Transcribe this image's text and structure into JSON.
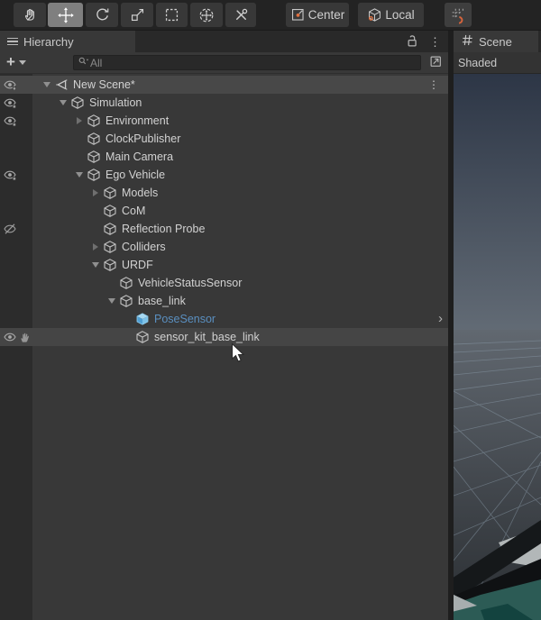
{
  "toolbar": {
    "tools": [
      {
        "id": "hand",
        "name": "hand-tool",
        "selected": false
      },
      {
        "id": "move",
        "name": "move-tool",
        "selected": true
      },
      {
        "id": "rotate",
        "name": "rotate-tool",
        "selected": false
      },
      {
        "id": "scale",
        "name": "scale-tool",
        "selected": false
      },
      {
        "id": "rect",
        "name": "rect-tool",
        "selected": false
      },
      {
        "id": "transform",
        "name": "transform-tool",
        "selected": false
      },
      {
        "id": "custom",
        "name": "custom-editor-tools",
        "selected": false
      }
    ],
    "pivot_label": "Center",
    "orientation_label": "Local",
    "grid_snap_icon": "grid-snap-icon"
  },
  "hierarchy": {
    "tab_label": "Hierarchy",
    "tab_icons": [
      "hamburger-menu-icon",
      "unlock-icon",
      "kebab-menu-icon"
    ],
    "add_button": "+",
    "search_placeholder": "All",
    "search_icons": [
      "search-filter-icon",
      "open-search-window-icon"
    ],
    "rows": [
      {
        "label": "New Scene*",
        "level": 0,
        "expand": "open",
        "icon": "unity",
        "eye": "dot",
        "header": true,
        "menu": true
      },
      {
        "label": "Simulation",
        "level": 1,
        "expand": "open",
        "icon": "cube",
        "eye": "dot"
      },
      {
        "label": "Environment",
        "level": 2,
        "expand": "closed",
        "icon": "cube",
        "eye": "dot"
      },
      {
        "label": "ClockPublisher",
        "level": 2,
        "icon": "cube"
      },
      {
        "label": "Main Camera",
        "level": 2,
        "icon": "cube"
      },
      {
        "label": "Ego Vehicle",
        "level": 2,
        "expand": "open",
        "icon": "cube",
        "eye": "dot"
      },
      {
        "label": "Models",
        "level": 3,
        "expand": "closed",
        "icon": "cube"
      },
      {
        "label": "CoM",
        "level": 3,
        "icon": "cube"
      },
      {
        "label": "Reflection Probe",
        "level": 3,
        "icon": "cube",
        "eye": "hidden"
      },
      {
        "label": "Colliders",
        "level": 3,
        "expand": "closed",
        "icon": "cube"
      },
      {
        "label": "URDF",
        "level": 3,
        "expand": "open",
        "icon": "cube"
      },
      {
        "label": "VehicleStatusSensor",
        "level": 4,
        "icon": "cube"
      },
      {
        "label": "base_link",
        "level": 4,
        "expand": "open",
        "icon": "cube"
      },
      {
        "label": "PoseSensor",
        "level": 5,
        "icon": "prefab",
        "prefab": true,
        "chevron": true
      },
      {
        "label": "sensor_kit_base_link",
        "level": 5,
        "icon": "cube",
        "eye": "plain",
        "pick": true,
        "hover": true
      }
    ]
  },
  "scene": {
    "tab_label": "Scene",
    "tab_icon": "grid-icon",
    "shading_mode": "Shaded"
  },
  "colors": {
    "prefab_text_blue": "#5a8fc0",
    "prefab_cube_top": "#a8d8f0",
    "prefab_cube_left": "#4f9fd4",
    "prefab_cube_right": "#7cc1e8",
    "gizmo_orange": "#e0703f",
    "sky_top": "#2d3646",
    "sky_horizon": "#636c76",
    "ground_grid_line": "#93a5b4",
    "hood_teal": "#2c5b55",
    "row_hover": "#454545",
    "scene_header_row": "#484848"
  }
}
